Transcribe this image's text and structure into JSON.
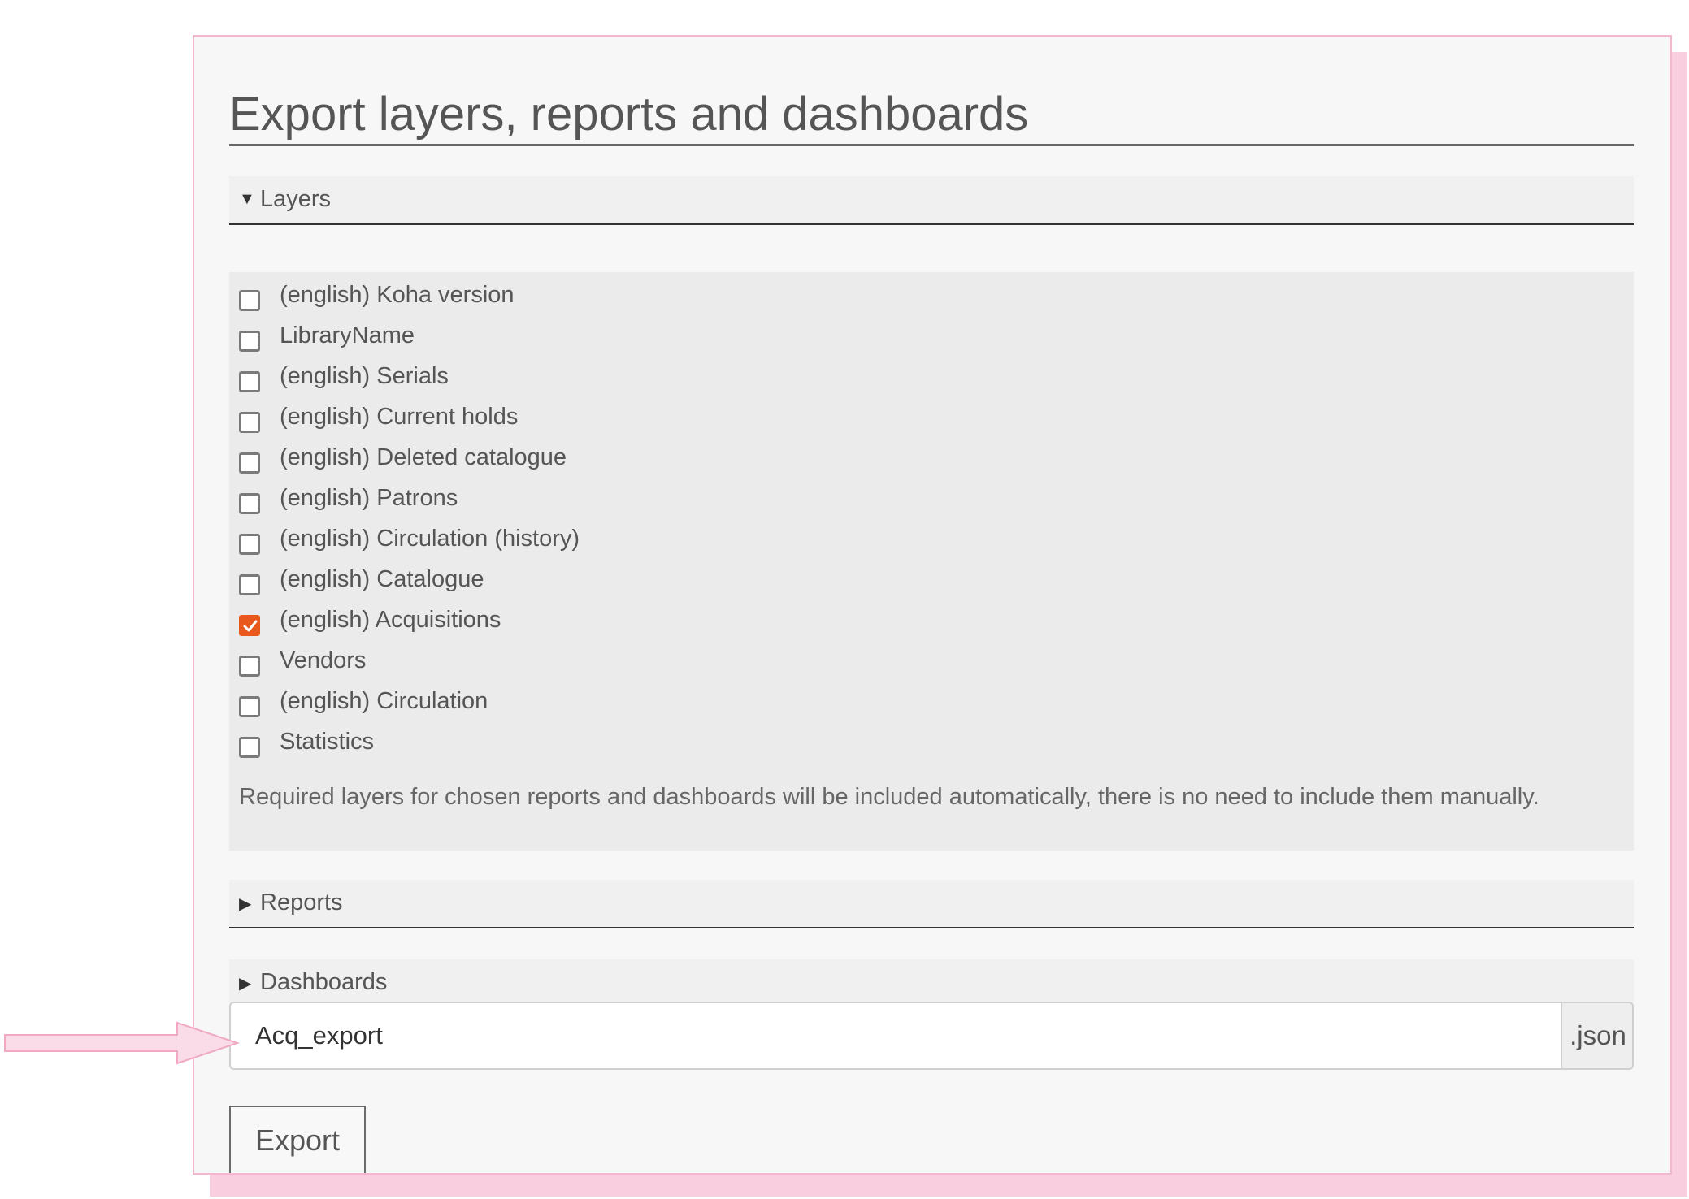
{
  "page": {
    "title": "Export layers, reports and dashboards"
  },
  "layers": {
    "heading": "Layers",
    "expanded": true,
    "items": [
      {
        "label": "(english) Koha version",
        "checked": false
      },
      {
        "label": "LibraryName",
        "checked": false
      },
      {
        "label": "(english) Serials",
        "checked": false
      },
      {
        "label": "(english) Current holds",
        "checked": false
      },
      {
        "label": "(english) Deleted catalogue",
        "checked": false
      },
      {
        "label": "(english) Patrons",
        "checked": false
      },
      {
        "label": "(english) Circulation (history)",
        "checked": false
      },
      {
        "label": "(english) Catalogue",
        "checked": false
      },
      {
        "label": "(english) Acquisitions",
        "checked": true
      },
      {
        "label": "Vendors",
        "checked": false
      },
      {
        "label": "(english) Circulation",
        "checked": false
      },
      {
        "label": "Statistics",
        "checked": false
      }
    ],
    "note": "Required layers for chosen reports and dashboards will be included automatically, there is no need to include them manually."
  },
  "reports": {
    "heading": "Reports",
    "expanded": false
  },
  "dashboards": {
    "heading": "Dashboards",
    "expanded": false
  },
  "filename": {
    "value": "Acq_export",
    "suffix": ".json"
  },
  "export_button": {
    "label": "Export"
  },
  "colors": {
    "accent_checkbox": "#e8581c",
    "annotation_arrow": "#f2a7c3"
  }
}
